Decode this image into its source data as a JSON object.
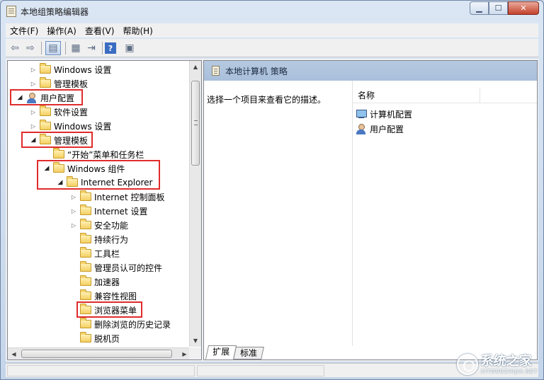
{
  "window": {
    "title": "本地组策略编辑器"
  },
  "menu": [
    "文件(F)",
    "操作(A)",
    "查看(V)",
    "帮助(H)"
  ],
  "tree": {
    "items": [
      {
        "label": "Windows 设置",
        "expander": "closed",
        "icon": "folder-icon"
      },
      {
        "label": "管理模板",
        "expander": "closed",
        "icon": "folder-icon"
      },
      {
        "label": "用户配置",
        "expander": "open",
        "icon": "user-icon"
      },
      {
        "label": "软件设置",
        "expander": "closed",
        "icon": "folder-icon"
      },
      {
        "label": "Windows 设置",
        "expander": "closed",
        "icon": "folder-icon"
      },
      {
        "label": "管理模板",
        "expander": "open",
        "icon": "folder-icon"
      },
      {
        "label": "“开始”菜单和任务栏",
        "expander": "none",
        "icon": "folder-icon"
      },
      {
        "label": "Windows 组件",
        "expander": "open",
        "icon": "folder-icon"
      },
      {
        "label": "Internet Explorer",
        "expander": "open",
        "icon": "folder-icon"
      },
      {
        "label": "Internet 控制面板",
        "expander": "closed",
        "icon": "folder-icon"
      },
      {
        "label": "Internet 设置",
        "expander": "closed",
        "icon": "folder-icon"
      },
      {
        "label": "安全功能",
        "expander": "closed",
        "icon": "folder-icon"
      },
      {
        "label": "持续行为",
        "expander": "none",
        "icon": "folder-icon"
      },
      {
        "label": "工具栏",
        "expander": "none",
        "icon": "folder-icon"
      },
      {
        "label": "管理员认可的控件",
        "expander": "none",
        "icon": "folder-icon"
      },
      {
        "label": "加速器",
        "expander": "none",
        "icon": "folder-icon"
      },
      {
        "label": "兼容性视图",
        "expander": "none",
        "icon": "folder-icon"
      },
      {
        "label": "浏览器菜单",
        "expander": "none",
        "icon": "folder-icon"
      },
      {
        "label": "删除浏览的历史记录",
        "expander": "none",
        "icon": "folder-icon"
      },
      {
        "label": "脱机页",
        "expander": "none",
        "icon": "folder-icon"
      }
    ],
    "highlight_color": "#e02c2c"
  },
  "right": {
    "header_title": "本地计算机 策略",
    "description": "选择一个项目来查看它的描述。",
    "column_name": "名称",
    "items": [
      {
        "label": "计算机配置",
        "icon": "computer-icon"
      },
      {
        "label": "用户配置",
        "icon": "user-icon"
      }
    ]
  },
  "tabs": [
    {
      "label": "扩展",
      "active": true
    },
    {
      "label": "标准",
      "active": false
    }
  ],
  "watermark": {
    "text": "系统之家",
    "sub": "XITONGZHIJIA.NET"
  }
}
